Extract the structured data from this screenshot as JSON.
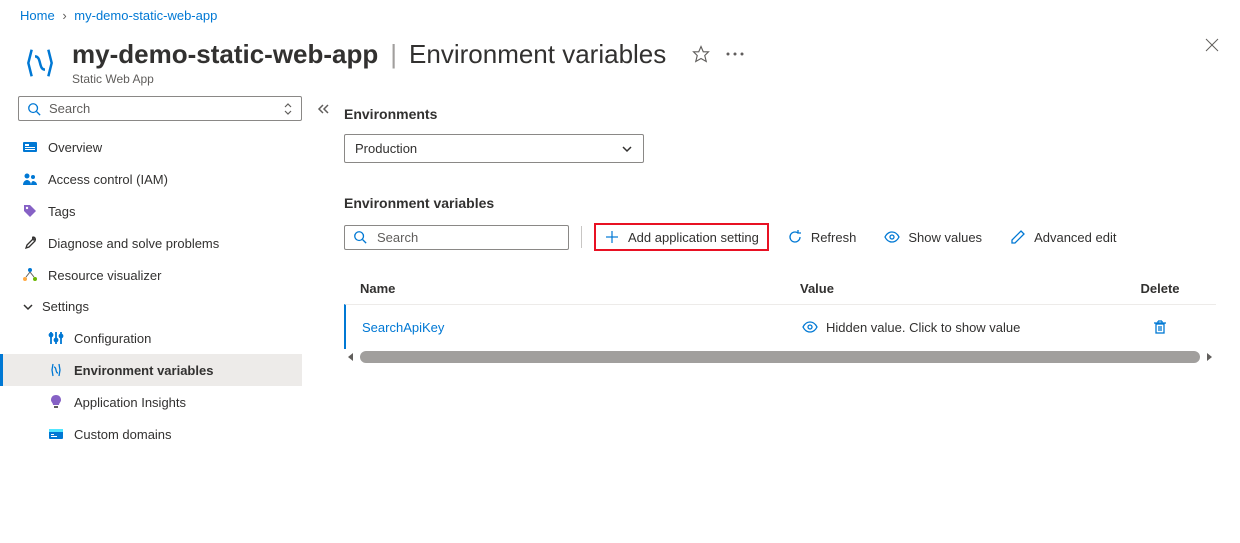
{
  "breadcrumb": [
    {
      "label": "Home"
    },
    {
      "label": "my-demo-static-web-app"
    }
  ],
  "header": {
    "title": "my-demo-static-web-app",
    "section": "Environment variables",
    "resourceType": "Static Web App"
  },
  "sidebar": {
    "searchPlaceholder": "Search",
    "items": {
      "overview": "Overview",
      "accessControl": "Access control (IAM)",
      "tags": "Tags",
      "diagnose": "Diagnose and solve problems",
      "resourceVisualizer": "Resource visualizer",
      "settings": "Settings",
      "configuration": "Configuration",
      "envVars": "Environment variables",
      "appInsights": "Application Insights",
      "customDomains": "Custom domains"
    }
  },
  "content": {
    "environmentsLabel": "Environments",
    "environmentSelected": "Production",
    "envVarsLabel": "Environment variables",
    "searchPlaceholder": "Search",
    "toolbar": {
      "addAppSetting": "Add application setting",
      "refresh": "Refresh",
      "showValues": "Show values",
      "advancedEdit": "Advanced edit"
    },
    "columns": {
      "name": "Name",
      "value": "Value",
      "delete": "Delete"
    },
    "rows": [
      {
        "name": "SearchApiKey",
        "value": "Hidden value. Click to show value"
      }
    ]
  }
}
